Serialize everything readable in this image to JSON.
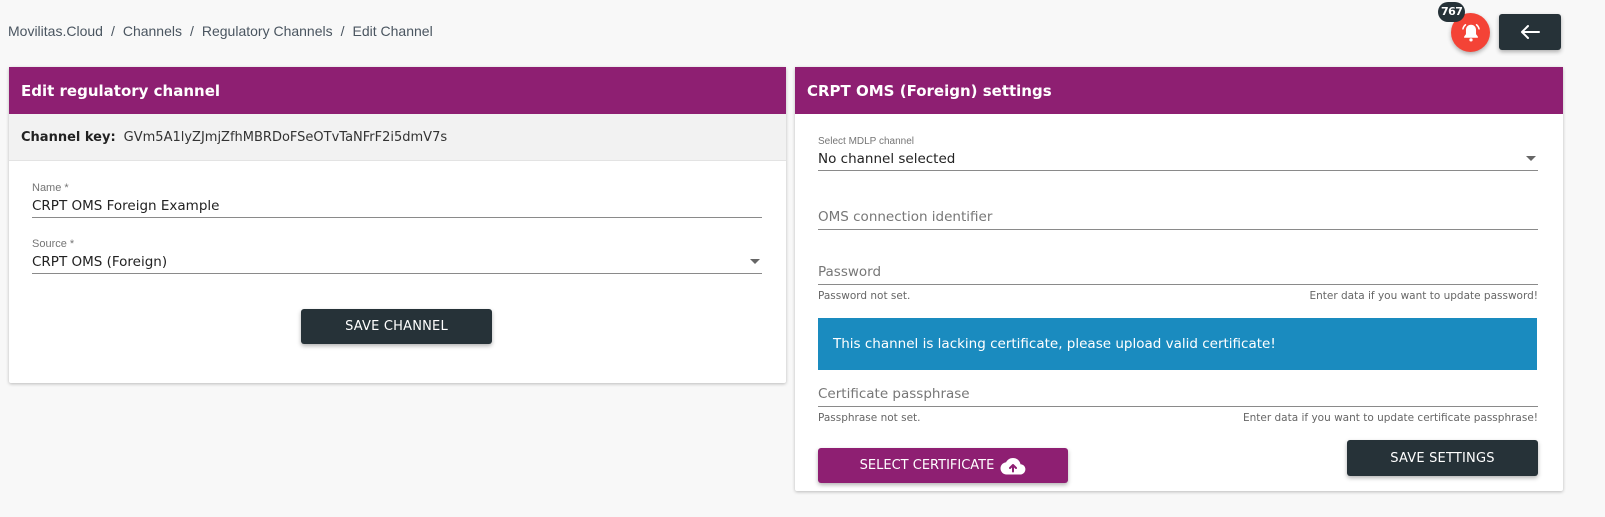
{
  "breadcrumb": {
    "items": [
      "Movilitas.Cloud",
      "Channels",
      "Regulatory Channels",
      "Edit Channel"
    ],
    "separator": "/"
  },
  "topbar": {
    "notification_count": "767",
    "notification_icon": "bell-icon",
    "back_icon": "arrow-left-icon"
  },
  "edit_card": {
    "title": "Edit regulatory channel",
    "channel_key_label": "Channel key:",
    "channel_key_value": "GVm5A1lyZJmjZfhMBRDoFSeOTvTaNFrF2i5dmV7s",
    "name_label": "Name *",
    "name_value": "CRPT OMS Foreign Example",
    "source_label": "Source *",
    "source_value": "CRPT OMS (Foreign)",
    "save_label": "SAVE CHANNEL"
  },
  "settings_card": {
    "title": "CRPT OMS (Foreign) settings",
    "mdlp_label": "Select MDLP channel",
    "mdlp_value": "No channel selected",
    "oms_placeholder": "OMS connection identifier",
    "password_placeholder": "Password",
    "password_hint_left": "Password not set.",
    "password_hint_right": "Enter data if you want to update password!",
    "alert_text": "This channel is lacking certificate, please upload valid certificate!",
    "passphrase_placeholder": "Certificate passphrase",
    "passphrase_hint_left": "Passphrase not set.",
    "passphrase_hint_right": "Enter data if you want to update certificate passphrase!",
    "select_cert_label": "SELECT CERTIFICATE",
    "save_settings_label": "SAVE SETTINGS"
  },
  "colors": {
    "header_purple": "#8e1f72",
    "dark_button": "#263238",
    "alert_blue": "#1a8bbf",
    "notification_red": "#f44336"
  }
}
